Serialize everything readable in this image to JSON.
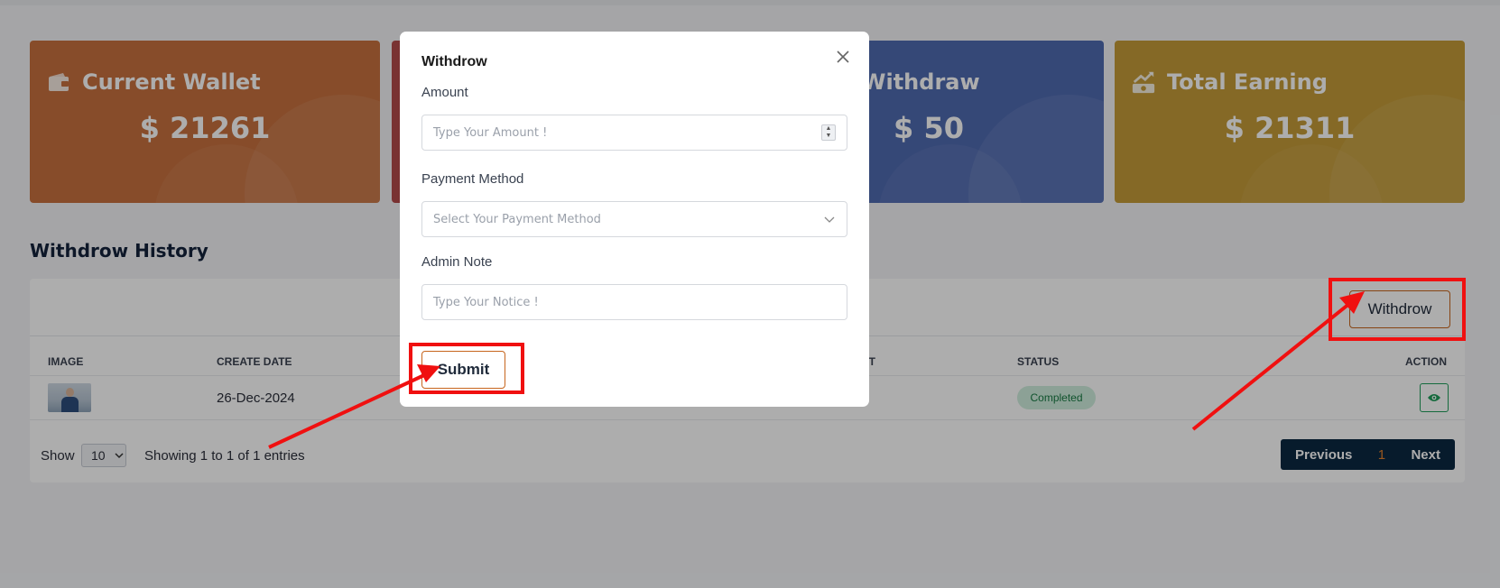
{
  "cards": [
    {
      "title": "Current Wallet",
      "value": "$ 21261",
      "icon": "wallet-icon",
      "color": "#c8713f"
    },
    {
      "title": "",
      "value": "",
      "icon": "",
      "color": "#b34b4a"
    },
    {
      "title": "Withdraw",
      "value": "$ 50",
      "icon": "",
      "color": "#4f6ab0"
    },
    {
      "title": "Total Earning",
      "value": "$ 21311",
      "icon": "money-growth-icon",
      "color": "#c49b38"
    }
  ],
  "history": {
    "title": "Withdrow History",
    "withdraw_button": "Withdrow",
    "columns": {
      "image": "IMAGE",
      "create_date": "CREATE DATE",
      "amount_partial": "NT",
      "status": "STATUS",
      "action": "ACTION"
    },
    "rows": [
      {
        "create_date": "26-Dec-2024",
        "status": "Completed"
      }
    ],
    "show_label": "Show",
    "page_size": "10",
    "entries_info": "Showing 1 to 1 of 1 entries",
    "pager": {
      "previous": "Previous",
      "current": "1",
      "next": "Next"
    }
  },
  "modal": {
    "title": "Withdrow",
    "amount_label": "Amount",
    "amount_placeholder": "Type Your Amount !",
    "payment_label": "Payment Method",
    "payment_placeholder": "Select Your Payment Method",
    "note_label": "Admin Note",
    "note_placeholder": "Type Your Notice !",
    "submit": "Submit"
  },
  "colors": {
    "accent": "#c7651d",
    "navy": "#0b2842",
    "annotation": "#f01010",
    "status_bg": "#cfeedd",
    "status_text": "#177a43"
  }
}
